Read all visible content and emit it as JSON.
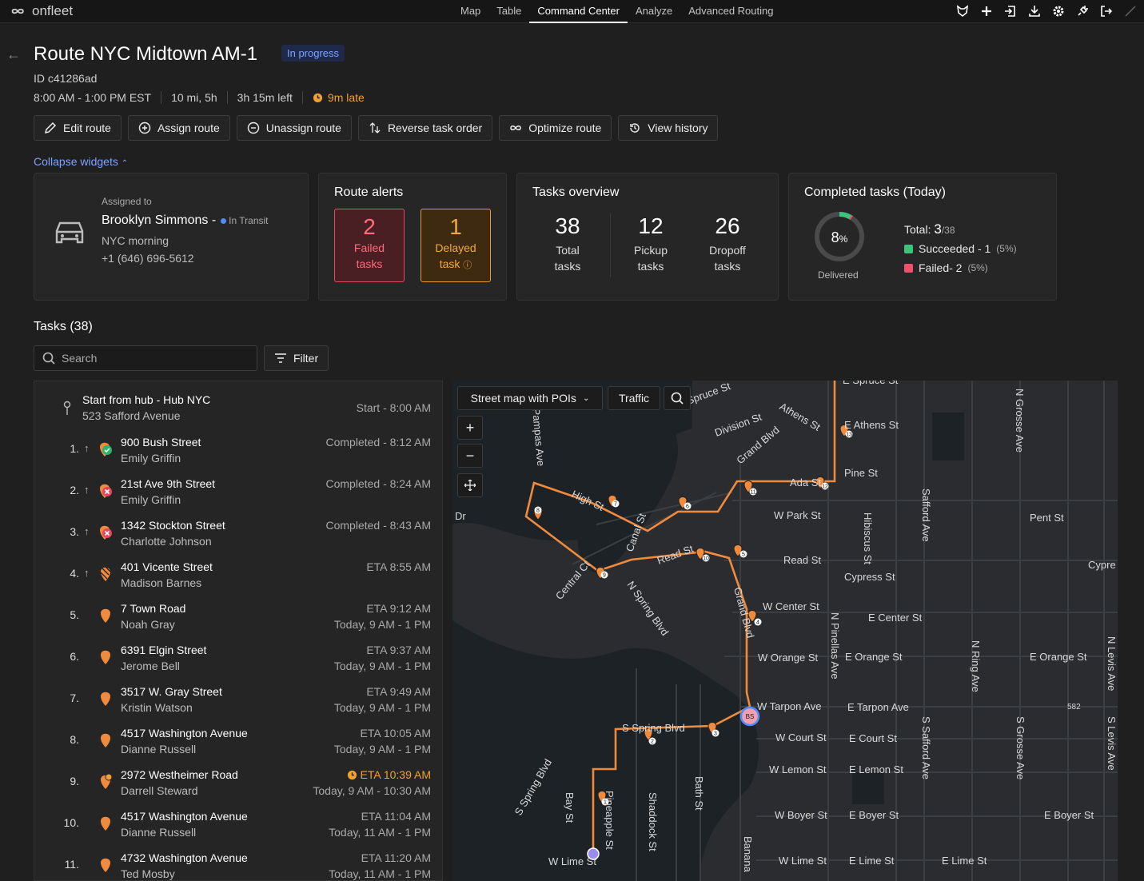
{
  "app": {
    "name": "onfleet"
  },
  "nav": {
    "tabs": [
      "Map",
      "Table",
      "Command Center",
      "Analyze",
      "Advanced Routing"
    ],
    "active": "Command Center"
  },
  "header": {
    "title": "Route NYC Midtown AM-1",
    "status": "In progress",
    "id": "ID c41286ad",
    "time_window": "8:00 AM - 1:00 PM EST",
    "distance": "10 mi, 5h",
    "time_left": "3h 15m left",
    "late": "9m late"
  },
  "actions": [
    "Edit route",
    "Assign route",
    "Unassign route",
    "Reverse task order",
    "Optimize route",
    "View history"
  ],
  "collapse_label": "Collapse widgets",
  "driver": {
    "assigned_label": "Assigned to",
    "name": "Brooklyn Simmons -",
    "status": "In Transit",
    "team": "NYC morning",
    "phone": "+1 (646) 696-5612"
  },
  "alerts": {
    "title": "Route alerts",
    "failed_count": "2",
    "failed_label": "Failed tasks",
    "delayed_count": "1",
    "delayed_label": "Delayed task"
  },
  "overview": {
    "title": "Tasks overview",
    "total": "38",
    "total_label": "Total tasks",
    "pickup": "12",
    "pickup_label": "Pickup tasks",
    "dropoff": "26",
    "dropoff_label": "Dropoff tasks"
  },
  "completed": {
    "title": "Completed tasks (Today)",
    "percent": "8",
    "percent_unit": "%",
    "percent_value": 0.08,
    "delivered_label": "Delivered",
    "total_label": "Total:",
    "total_value": "3",
    "total_of": "/38",
    "succeeded": "Succeeded - 1",
    "succeeded_pct": "(5%)",
    "failed": "Failed- 2",
    "failed_pct": "(5%)",
    "succeeded_color": "#3cc47c",
    "failed_color": "#f0506e"
  },
  "tasks": {
    "heading": "Tasks (38)",
    "search_placeholder": "Search",
    "filter_label": "Filter",
    "start": {
      "title": "Start from hub - Hub NYC",
      "address": "523 Safford Avenue",
      "time": "Start - 8:00 AM"
    },
    "rows": [
      {
        "num": "1.",
        "addr": "900 Bush Street",
        "person": "Emily Griffin",
        "r1": "Completed - 8:12 AM",
        "r2": "",
        "status": "success"
      },
      {
        "num": "2.",
        "addr": "21st Ave 9th Street",
        "person": "Emily Griffin",
        "r1": "Completed - 8:24 AM",
        "r2": "",
        "status": "failed"
      },
      {
        "num": "3.",
        "addr": "1342 Stockton Street",
        "person": "Charlotte Johnson",
        "r1": "Completed - 8:43 AM",
        "r2": "",
        "status": "failed"
      },
      {
        "num": "4.",
        "addr": "401 Vicente Street",
        "person": "Madison Barnes",
        "r1": "ETA 8:55 AM",
        "r2": "",
        "status": "active"
      },
      {
        "num": "5.",
        "addr": "7 Town Road",
        "person": "Noah Gray",
        "r1": "ETA 9:12 AM",
        "r2": "Today, 9 AM - 1 PM",
        "status": "pending"
      },
      {
        "num": "6.",
        "addr": "6391 Elgin Street",
        "person": "Jerome Bell",
        "r1": "ETA 9:37 AM",
        "r2": "Today, 9 AM - 1 PM",
        "status": "pending"
      },
      {
        "num": "7.",
        "addr": "3517 W. Gray Street",
        "person": "Kristin Watson",
        "r1": "ETA 9:49 AM",
        "r2": "Today, 9 AM - 1 PM",
        "status": "pending"
      },
      {
        "num": "8.",
        "addr": "4517 Washington Avenue",
        "person": "Dianne Russell",
        "r1": "ETA 10:05 AM",
        "r2": "Today, 9 AM - 1 PM",
        "status": "pending"
      },
      {
        "num": "9.",
        "addr": "2972 Westheimer Road",
        "person": "Darrell Steward",
        "r1": "ETA 10:39 AM",
        "r2": "Today, 9 AM - 10:30 AM",
        "status": "late"
      },
      {
        "num": "10.",
        "addr": "4517 Washington Avenue",
        "person": "Dianne Russell",
        "r1": "ETA 11:04 AM",
        "r2": "Today, 11 AM - 1 PM",
        "status": "pending"
      },
      {
        "num": "11.",
        "addr": "4732 Washington Avenue",
        "person": "Ted Mosby",
        "r1": "ETA 11:20 AM",
        "r2": "Today, 11 AM - 1 PM",
        "status": "pending"
      }
    ]
  },
  "map": {
    "layer": "Street map with POIs",
    "traffic": "Traffic",
    "hub": "BS",
    "route_color": "#f08a3c",
    "streets": [
      "E Spruce St",
      "Spruce St",
      "Division St",
      "Athens St",
      "E Athens St",
      "Grand Blvd",
      "Pampas Ave",
      "Pine St",
      "Ada St",
      "High St",
      "W Park St",
      "Pent St",
      "Hibiscus St",
      "Safford Ave",
      "N Grosse Ave",
      "Canal St",
      "Read St",
      "Read St",
      "Cypress St",
      "Cypre",
      "Dr",
      "Central Ct",
      "N Spring Blvd",
      "W Center St",
      "E Center St",
      "Grand Blvd",
      "W Orange St",
      "E Orange St",
      "E Orange St",
      "N Pinellas Ave",
      "N Ring Ave",
      "N Levis Ave",
      "W Tarpon Ave",
      "E Tarpon Ave",
      "582",
      "S Spring Blvd",
      "W Court St",
      "E Court St",
      "S Safford Ave",
      "S Grosse Ave",
      "S Levis Ave",
      "W Lemon St",
      "E Lemon St",
      "S Spring Blvd",
      "Bay St",
      "Pineapple St",
      "Shaddock St",
      "Bath St",
      "W Boyer St",
      "E Boyer St",
      "E Boyer St",
      "Banana",
      "W Lime St",
      "W Lime St",
      "E Lime St",
      "E Lime St"
    ]
  }
}
